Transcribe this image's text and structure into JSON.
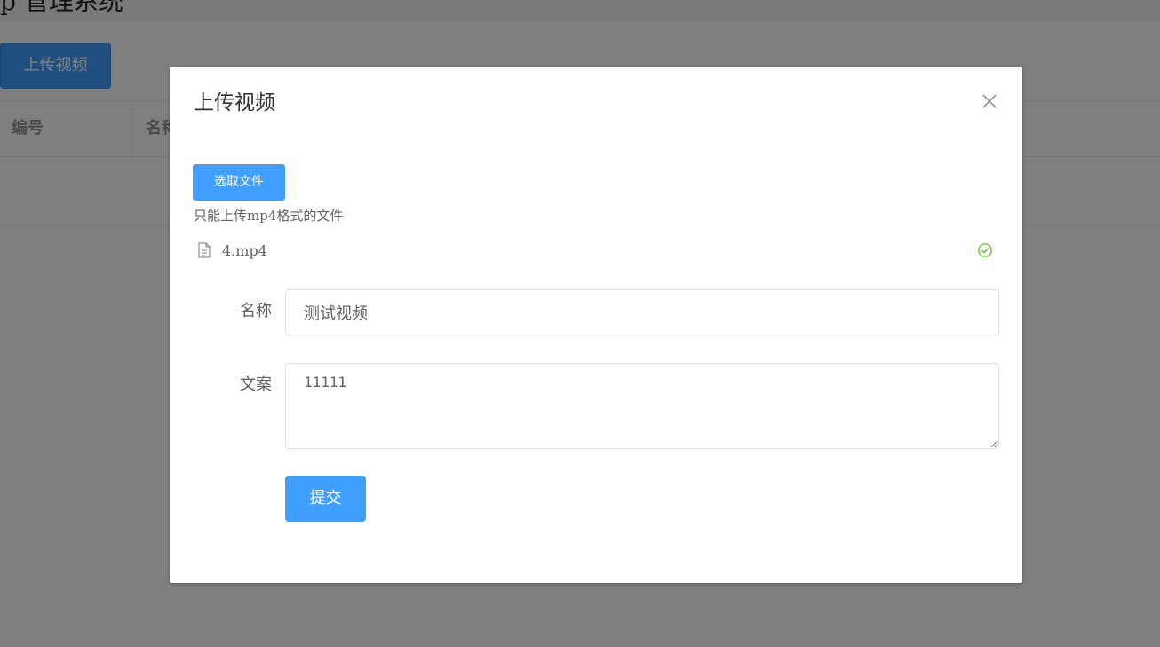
{
  "background": {
    "page_title": "p    管理系统",
    "upload_button_label": "上传视频",
    "table_headers": [
      "编号",
      "名称"
    ]
  },
  "dialog": {
    "title": "上传视频",
    "select_file_label": "选取文件",
    "upload_tip": "只能上传mp4格式的文件",
    "file_name": "4.mp4",
    "fields": {
      "name_label": "名称",
      "name_value": "测试视频",
      "copy_label": "文案",
      "copy_value": "11111"
    },
    "submit_label": "提交"
  },
  "colors": {
    "primary": "#409eff",
    "success": "#67c23a",
    "mask": "rgba(0,0,0,0.5)"
  },
  "icons": {
    "close": "close-icon",
    "file": "document-icon",
    "success": "circle-check-icon"
  }
}
